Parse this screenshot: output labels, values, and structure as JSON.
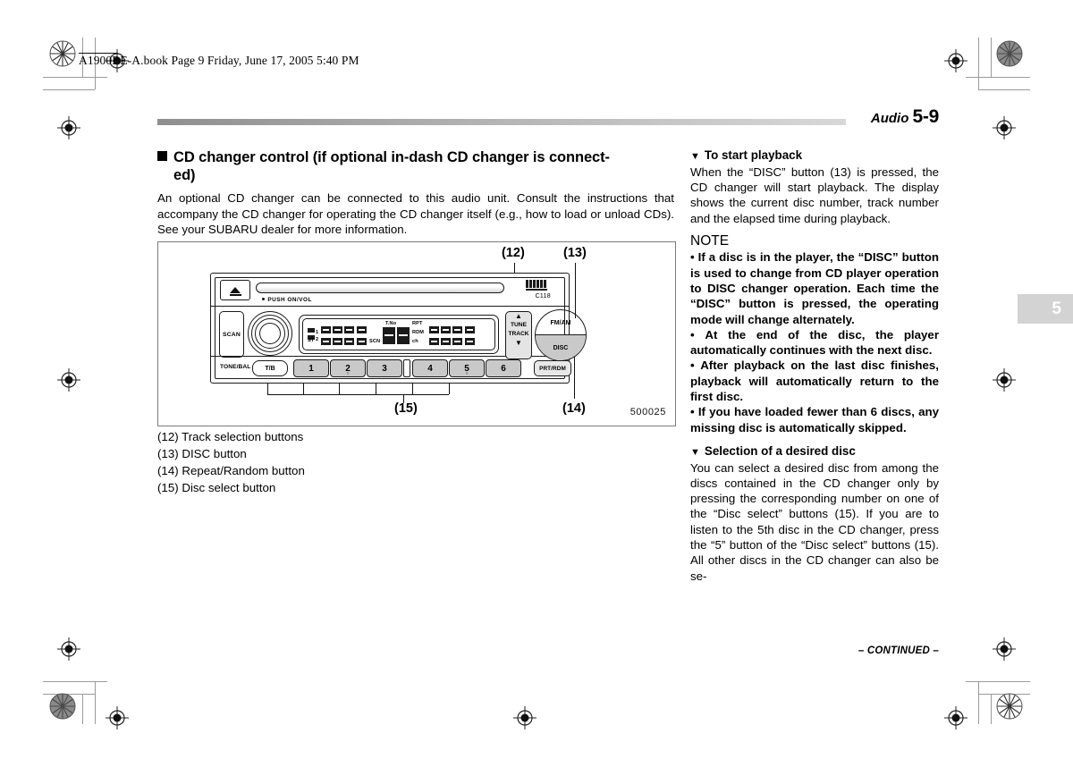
{
  "print_marks": {
    "book_line": "A1900BE-A.book  Page 9  Friday, June 17, 2005  5:40 PM"
  },
  "running_head": {
    "chapter_label": "Audio",
    "page_number": "5-9",
    "chapter_tab": "5"
  },
  "left_column": {
    "heading_line1": "CD changer control (if optional in-dash CD changer is connect-",
    "heading_line2": "ed)",
    "intro": "An optional CD changer can be connected to this audio unit. Consult the instructions that accompany the CD changer for operating the CD changer itself (e.g., how to load or unload CDs). See your SUBARU dealer for more information.",
    "legend": [
      "(12) Track selection buttons",
      "(13) DISC button",
      "(14) Repeat/Random button",
      "(15) Disc select button"
    ]
  },
  "figure": {
    "image_code": "500025",
    "callouts": {
      "c12": "(12)",
      "c13": "(13)",
      "c14": "(14)",
      "c15": "(15)"
    },
    "radio": {
      "eject_icon": "eject-icon",
      "push_vol_label": "PUSH ON/VOL",
      "cd_logo_text": "C118",
      "scan_label": "SCAN",
      "tune_up_icon": "chevron-up-icon",
      "tune_label": "TUNE",
      "track_label": "TRACK",
      "tune_down_icon": "chevron-down-icon",
      "fm_am_label": "FM/AM",
      "disc_label": "DISC",
      "tone_bal_label": "TONE/BAL",
      "tb_label": "T/B",
      "prt_rdm_label": "PRT/RDM",
      "presets": [
        "1",
        "2",
        "3",
        "4",
        "5",
        "6"
      ],
      "lcd": {
        "disc1_label": "1",
        "disc2_label": "2",
        "stereo_label": "ST",
        "scan_label": "SCN",
        "track_no_label": "T.No",
        "repeat_label": "RPT",
        "random_label": "RDM",
        "channel_label": "ch",
        "digits": "88"
      }
    }
  },
  "right_column": {
    "playback": {
      "heading": "To start playback",
      "body": "When the “DISC” button (13) is pressed, the CD changer will start playback. The display shows the current disc number, track number and the elapsed time during playback."
    },
    "note": {
      "heading": "NOTE",
      "bullets": [
        "If a disc is in the player, the “DISC” button is used to change from CD player operation to DISC changer operation. Each time the “DISC” button is pressed, the operating mode will change alternately.",
        "At the end of the disc, the player automatically continues with the next disc.",
        "After playback on the last disc finishes, playback will automatically return to the first disc.",
        "If you have loaded fewer than 6 discs, any missing disc is automatically skipped."
      ]
    },
    "selection": {
      "heading": "Selection of a desired disc",
      "body": "You can select a desired disc from among the discs contained in the CD changer only by pressing the corresponding number on one of the “Disc select” buttons (15). If you are to listen to the 5th disc in the CD changer, press the “5” button of the “Disc select” buttons (15). All other discs in the CD changer can also be se-"
    },
    "footer": "– CONTINUED –"
  }
}
